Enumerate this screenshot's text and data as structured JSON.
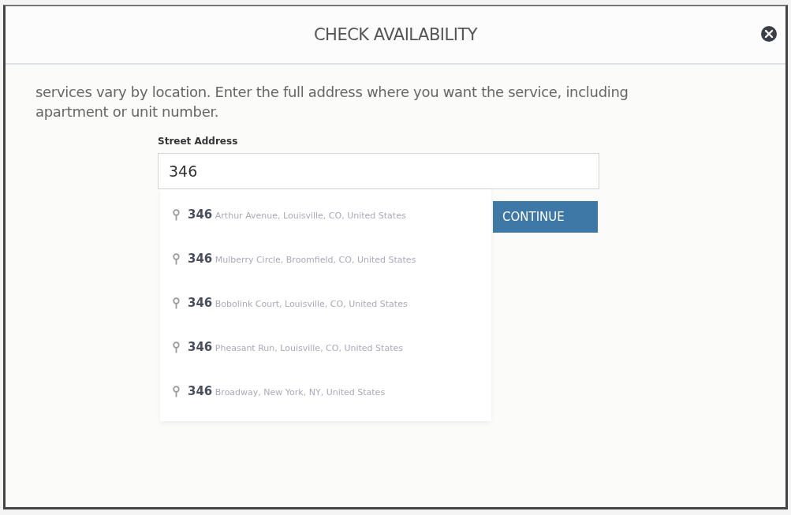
{
  "dialog": {
    "title": "CHECK AVAILABILITY",
    "intro": "services vary by location. Enter the full address where you want the service, including apartment or unit number.",
    "street_address": {
      "label": "Street Address",
      "value": "346"
    },
    "suggestions": [
      {
        "text": "**346** Arthur Avenue, Louisville, CO, United States"
      },
      {
        "text": "**346** Mulberry Circle, Broomfield, CO, United States"
      },
      {
        "text": "**346** Bobolink Court, Louisville, CO, United States"
      },
      {
        "text": "**346** Pheasant Run, Louisville, CO, United States"
      },
      {
        "text": "**346** Broadway, New York, NY, United States"
      }
    ],
    "continue_button": "CONTINUE"
  }
}
